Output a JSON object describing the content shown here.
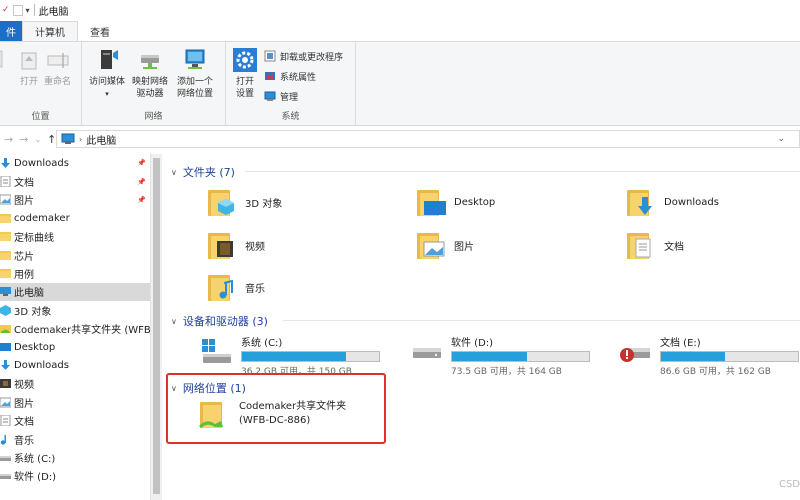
{
  "title": "此电脑",
  "tabs": {
    "file": "件",
    "computer": "计算机",
    "view": "查看"
  },
  "ribbon": {
    "location_group": {
      "open": "打开",
      "rename": "重命名",
      "label": "位置"
    },
    "network_group": {
      "media": "访问媒体",
      "map_drive": [
        "映射网络",
        "驱动器"
      ],
      "add_location": [
        "添加一个",
        "网络位置"
      ],
      "label": "网络"
    },
    "system_group": {
      "open_settings": [
        "打开",
        "设置"
      ],
      "uninstall": "卸载或更改程序",
      "properties": "系统属性",
      "manage": "管理",
      "label": "系统"
    }
  },
  "address": {
    "path": "此电脑"
  },
  "sidebar": {
    "items": [
      {
        "label": "Downloads",
        "pinned": true
      },
      {
        "label": "文档",
        "pinned": true
      },
      {
        "label": "图片",
        "pinned": true
      },
      {
        "label": "codemaker"
      },
      {
        "label": "定标曲线"
      },
      {
        "label": "芯片"
      },
      {
        "label": "用例"
      },
      {
        "label": "此电脑",
        "selected": true
      },
      {
        "label": "3D 对象"
      },
      {
        "label": "Codemaker共享文件夹 (WFB-"
      },
      {
        "label": "Desktop"
      },
      {
        "label": "Downloads"
      },
      {
        "label": "视频"
      },
      {
        "label": "图片"
      },
      {
        "label": "文档"
      },
      {
        "label": "音乐"
      },
      {
        "label": "系统 (C:)"
      },
      {
        "label": "软件 (D:)"
      }
    ]
  },
  "sections": {
    "folders": {
      "header": "文件夹 (7)",
      "items": [
        "3D 对象",
        "Desktop",
        "Downloads",
        "视频",
        "图片",
        "文档",
        "音乐"
      ]
    },
    "drives": {
      "header": "设备和驱动器 (3)",
      "items": [
        {
          "name": "系统 (C:)",
          "size": "36.2 GB 可用，共 150 GB",
          "used_fraction": 0.76
        },
        {
          "name": "软件 (D:)",
          "size": "73.5 GB 可用，共 164 GB",
          "used_fraction": 0.55
        },
        {
          "name": "文档 (E:)",
          "size": "86.6 GB 可用，共 162 GB",
          "used_fraction": 0.47
        }
      ]
    },
    "network": {
      "header": "网络位置 (1)",
      "item": {
        "line1": "Codemaker共享文件夹",
        "line2": "(WFB-DC-886)"
      }
    }
  },
  "watermark": "CSD",
  "colors": {
    "accent": "#1a6fc8",
    "bar": "#26a0da",
    "highlight": "#e0302a",
    "section": "#1e3f9a"
  }
}
